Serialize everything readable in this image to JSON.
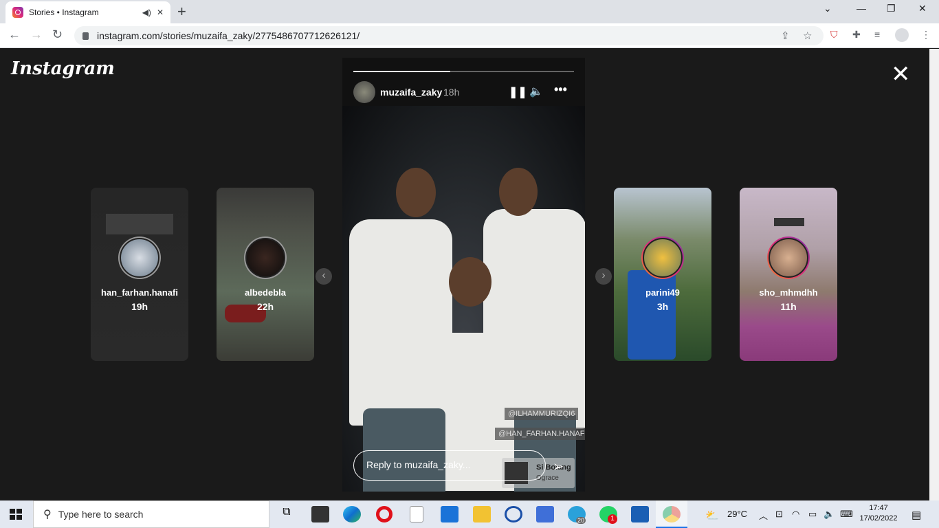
{
  "browser": {
    "tab_title": "Stories • Instagram",
    "url": "instagram.com/stories/muzaifa_zaky/2775486707712626121/"
  },
  "page": {
    "logo": "Instagram"
  },
  "stories_left": [
    {
      "username": "han_farhan.hanafi",
      "time": "19h"
    },
    {
      "username": "albedebla",
      "time": "22h"
    }
  ],
  "stories_right": [
    {
      "username": "parini49",
      "time": "3h"
    },
    {
      "username": "sho_mhmdhh",
      "time": "11h"
    }
  ],
  "current_story": {
    "username": "muzaifa_zaky",
    "time": "18h",
    "progress": 0.44,
    "tags": [
      "@ILHAMMURIZQI6",
      "@HAN_FARHAN.HANAFI"
    ],
    "music_title": "Si Bolang",
    "music_artist": "Ograce",
    "reply_placeholder": "Reply to muzaifa_zaky..."
  },
  "taskbar": {
    "search_placeholder": "Type here to search",
    "temperature": "29°C",
    "time": "17:47",
    "date": "17/02/2022",
    "whatsapp_badge": "1",
    "telegram_badge": "20"
  },
  "colors": {
    "page_bg": "#1a1a1a",
    "story_ring": "#dd2a7b"
  }
}
